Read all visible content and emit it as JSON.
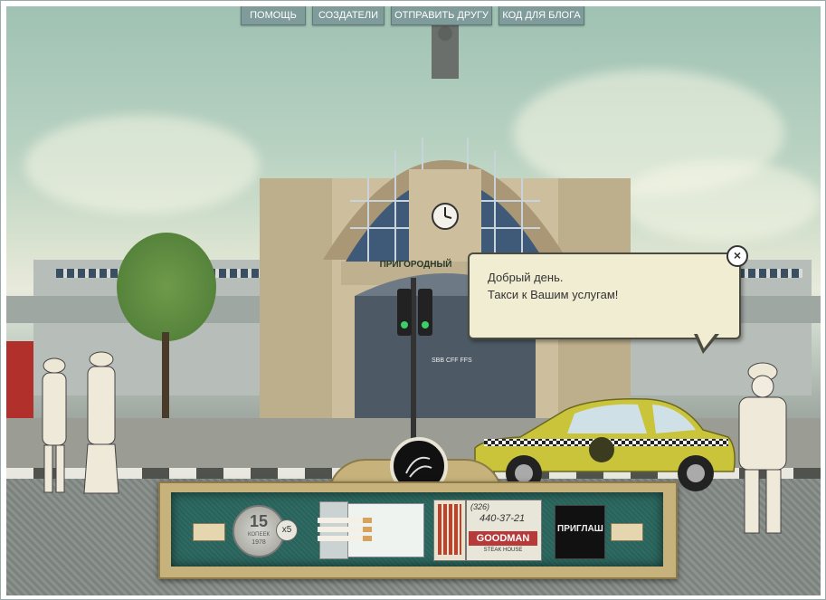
{
  "top_menu": {
    "help": "ПОМОЩЬ",
    "creators": "СОЗДАТЕЛИ",
    "send_friend": "ОТПРАВИТЬ ДРУГУ",
    "blog_code": "КОД ДЛЯ БЛОГА"
  },
  "station": {
    "sign": "ПРИГОРОДНЫЙ",
    "board": "SBB CFF FFS"
  },
  "dialog": {
    "text": "Добрый день.\nТакси к Вашим услугам!",
    "close_symbol": "×"
  },
  "inventory": {
    "coin_value": "15",
    "coin_label": "КОПЕЕК",
    "coin_year": "1978",
    "coin_count": "x5",
    "matchbox_code": "(326)",
    "matchbox_phone": "440-37-21",
    "matchbox_brand": "GOODMAN",
    "matchbox_sub": "STEAK HOUSE",
    "card_text": "ПРИГЛАШ"
  },
  "colors": {
    "menu_button": "#7f9c9a",
    "taxi": "#c9c43a",
    "inventory_bg": "#2e6b62",
    "inventory_frame": "#c6b27a"
  },
  "icons": {
    "close": "close-icon",
    "map": "map-icon",
    "left_arrow": "arrow-left-icon",
    "right_arrow": "arrow-right-icon"
  }
}
